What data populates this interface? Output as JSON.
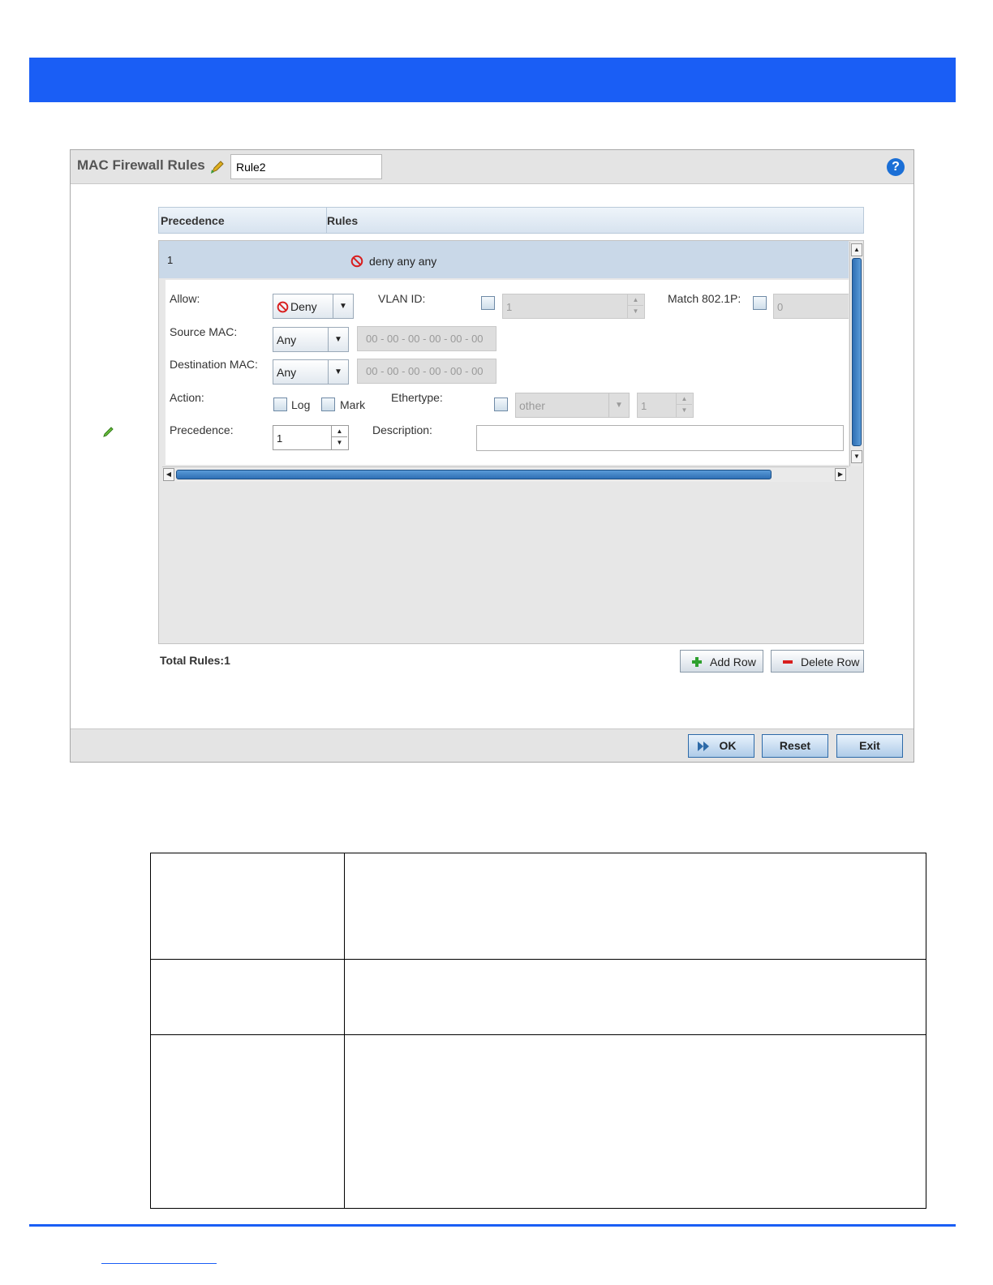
{
  "dialog": {
    "title": "MAC Firewall Rules",
    "rule_name_value": "Rule2",
    "help": "?"
  },
  "table": {
    "headers": [
      "Precedence",
      "Rules"
    ],
    "rows": [
      {
        "precedence": "1",
        "rule": "deny any any"
      }
    ]
  },
  "editor": {
    "allow_label": "Allow:",
    "allow_value": "Deny",
    "vlan_label": "VLAN ID:",
    "vlan_value": "1",
    "match_label": "Match 802.1P:",
    "match_value": "0",
    "source_mac_label": "Source MAC:",
    "source_mac_mode": "Any",
    "source_mac_value": "00 - 00 - 00 - 00 - 00 - 00",
    "dest_mac_label": "Destination MAC:",
    "dest_mac_mode": "Any",
    "dest_mac_value": "00 - 00 - 00 - 00 - 00 - 00",
    "action_label": "Action:",
    "log_label": "Log",
    "mark_label": "Mark",
    "ethertype_label": "Ethertype:",
    "ethertype_value": "other",
    "ethertype_number": "1",
    "precedence_label": "Precedence:",
    "precedence_value": "1",
    "description_label": "Description:"
  },
  "summary": {
    "total_rules": "Total Rules:1",
    "add_row": "Add Row",
    "delete_row": "Delete Row"
  },
  "footer": {
    "ok": "OK",
    "reset": "Reset",
    "exit": "Exit"
  },
  "colors": {
    "brand_blue": "#1a5ef5",
    "row_selected": "#c9d8e8",
    "deny_red": "#d81e1e",
    "add_green": "#2ea02e"
  }
}
